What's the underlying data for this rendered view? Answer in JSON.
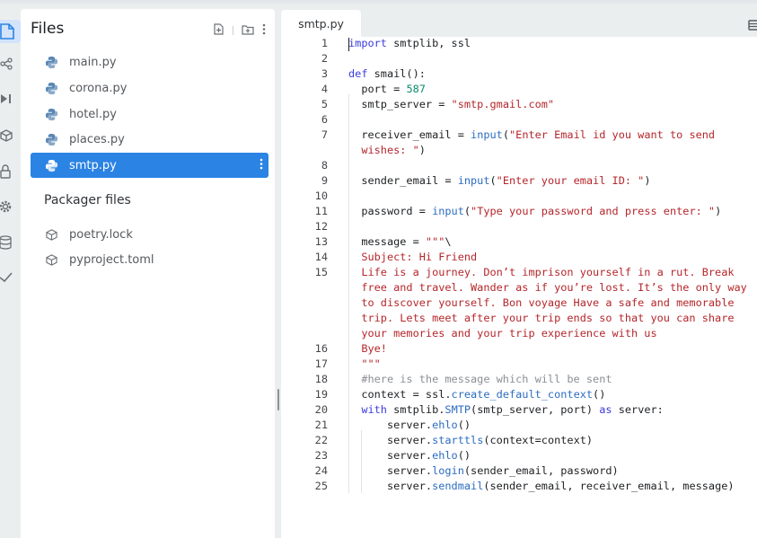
{
  "files_panel": {
    "title": "Files",
    "files": [
      {
        "name": "main.py",
        "icon": "python-icon"
      },
      {
        "name": "corona.py",
        "icon": "python-icon"
      },
      {
        "name": "hotel.py",
        "icon": "python-icon"
      },
      {
        "name": "places.py",
        "icon": "python-icon"
      },
      {
        "name": "smtp.py",
        "icon": "python-icon",
        "selected": true
      }
    ],
    "packager_title": "Packager files",
    "packager_files": [
      {
        "name": "poetry.lock",
        "icon": "package-icon"
      },
      {
        "name": "pyproject.toml",
        "icon": "package-icon"
      }
    ]
  },
  "editor": {
    "tab_label": "smtp.py",
    "line_numbers": [
      "1",
      "2",
      "3",
      "4",
      "5",
      "6",
      "7",
      "8",
      "9",
      "10",
      "11",
      "12",
      "13",
      "14",
      "15",
      "16",
      "17",
      "18",
      "19",
      "20",
      "21",
      "22",
      "23",
      "24",
      "25"
    ],
    "code_text": [
      "import smtplib, ssl",
      "",
      "def smail():",
      "  port = 587",
      "  smtp_server = \"smtp.gmail.com\"",
      "",
      "  receiver_email = input(\"Enter Email id you want to send",
      "  wishes: \")",
      "",
      "  sender_email = input(\"Enter your email ID: \")",
      "",
      "  password = input(\"Type your password and press enter: \")",
      "",
      "  message = \"\"\"\\",
      "  Subject: Hi Friend",
      "  Life is a journey. Don’t imprison yourself in a rut. Break",
      "  free and travel. Wander as if you’re lost. It’s the only way",
      "  to discover yourself. Bon voyage Have a safe and memorable",
      "  trip. Lets meet after your trip ends so that you can share",
      "  your memories and your trip experience with us",
      "  Bye!",
      "  \"\"\"",
      "  #here is the message which will be sent",
      "  context = ssl.create_default_context()",
      "  with smtplib.SMTP(smtp_server, port) as server:",
      "      server.ehlo()",
      "      server.starttls(context=context)",
      "      server.ehlo()",
      "      server.login(sender_email, password)",
      "      server.sendmail(sender_email, receiver_email, message)"
    ]
  },
  "colors": {
    "accent": "#2b83e3",
    "keyword": "#3a3adf",
    "function": "#2c6cbf",
    "number": "#0d8a6a",
    "string": "#b5262b",
    "comment": "#8b8f93"
  }
}
